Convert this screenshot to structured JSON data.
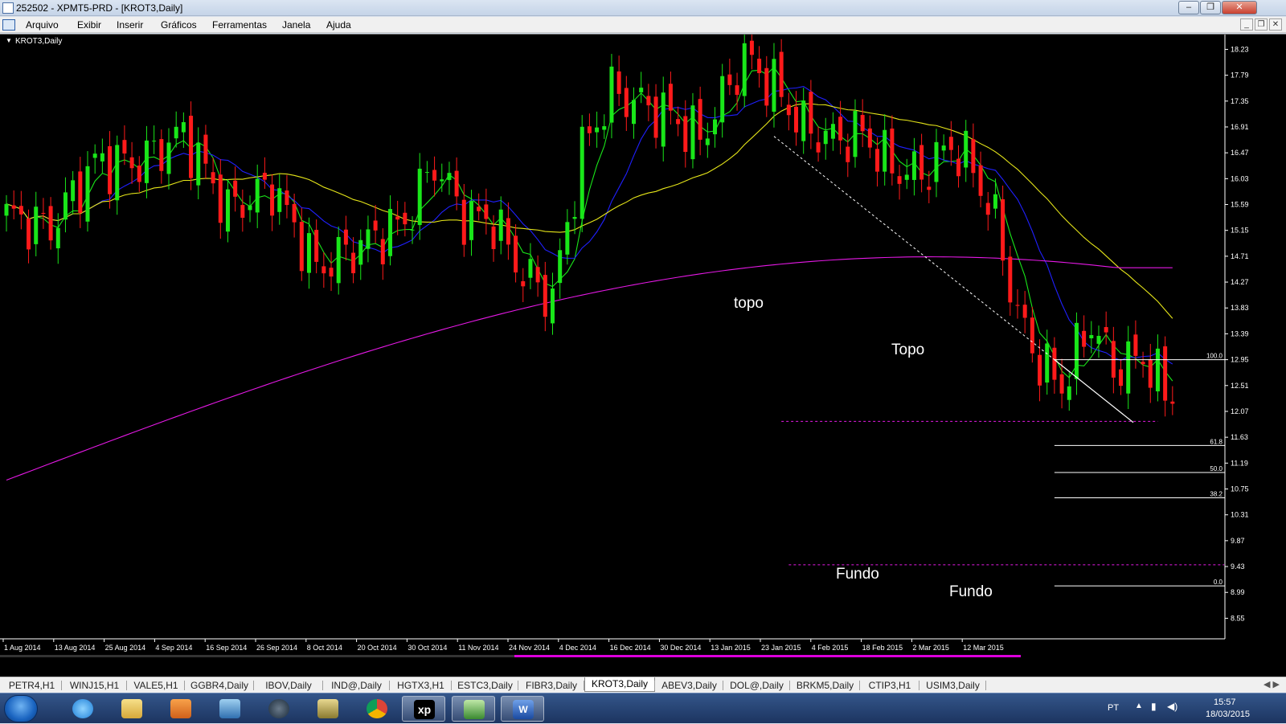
{
  "window": {
    "title": "252502 - XPMT5-PRD - [KROT3,Daily]"
  },
  "menu": [
    "Arquivo",
    "Exibir",
    "Inserir",
    "Gráficos",
    "Ferramentas",
    "Janela",
    "Ajuda"
  ],
  "chart_data": {
    "type": "candlestick",
    "symbol": "KROT3,Daily",
    "ylim": [
      8.2,
      18.4
    ],
    "y_ticks": [
      "18.23",
      "17.79",
      "17.35",
      "16.91",
      "16.47",
      "16.03",
      "15.59",
      "15.15",
      "14.71",
      "14.27",
      "13.83",
      "13.39",
      "12.95",
      "12.51",
      "12.07",
      "11.63",
      "11.19",
      "10.75",
      "10.31",
      "9.87",
      "9.43",
      "8.99",
      "8.55"
    ],
    "x_ticks": [
      "1 Aug 2014",
      "13 Aug 2014",
      "25 Aug 2014",
      "4 Sep 2014",
      "16 Sep 2014",
      "26 Sep 2014",
      "8 Oct 2014",
      "20 Oct 2014",
      "30 Oct 2014",
      "11 Nov 2014",
      "24 Nov 2014",
      "4 Dec 2014",
      "16 Dec 2014",
      "30 Dec 2014",
      "13 Jan 2015",
      "23 Jan 2015",
      "4 Feb 2015",
      "18 Feb 2015",
      "2 Mar 2015",
      "12 Mar 2015"
    ],
    "candle_count": 159,
    "anchors": [
      {
        "bar": 0,
        "close": 15.4
      },
      {
        "bar": 6,
        "close": 15.2
      },
      {
        "bar": 12,
        "close": 16.3
      },
      {
        "bar": 18,
        "close": 16.3
      },
      {
        "bar": 24,
        "close": 16.8
      },
      {
        "bar": 30,
        "close": 15.5
      },
      {
        "bar": 36,
        "close": 15.9
      },
      {
        "bar": 42,
        "close": 14.5
      },
      {
        "bar": 48,
        "close": 14.9
      },
      {
        "bar": 54,
        "close": 15.3
      },
      {
        "bar": 58,
        "close": 16.3
      },
      {
        "bar": 62,
        "close": 15.4
      },
      {
        "bar": 66,
        "close": 15.3
      },
      {
        "bar": 70,
        "close": 14.4
      },
      {
        "bar": 74,
        "close": 14.0
      },
      {
        "bar": 78,
        "close": 16.5
      },
      {
        "bar": 82,
        "close": 17.5
      },
      {
        "bar": 86,
        "close": 17.3
      },
      {
        "bar": 90,
        "close": 17.1
      },
      {
        "bar": 94,
        "close": 16.7
      },
      {
        "bar": 100,
        "close": 18.1
      },
      {
        "bar": 104,
        "close": 17.6
      },
      {
        "bar": 108,
        "close": 16.9
      },
      {
        "bar": 112,
        "close": 16.7
      },
      {
        "bar": 116,
        "close": 16.8
      },
      {
        "bar": 120,
        "close": 16.2
      },
      {
        "bar": 124,
        "close": 16.1
      },
      {
        "bar": 128,
        "close": 16.6
      },
      {
        "bar": 131,
        "close": 16.2
      },
      {
        "bar": 134,
        "close": 15.3
      },
      {
        "bar": 137,
        "close": 13.7
      },
      {
        "bar": 140,
        "close": 12.9
      },
      {
        "bar": 143,
        "close": 12.5
      },
      {
        "bar": 147,
        "close": 13.6
      },
      {
        "bar": 150,
        "close": 12.8
      },
      {
        "bar": 154,
        "close": 13.0
      },
      {
        "bar": 158,
        "close": 12.2
      }
    ],
    "indicators": [
      {
        "name": "MA green",
        "color": "#19e619"
      },
      {
        "name": "MA blue",
        "color": "#2020ff"
      },
      {
        "name": "MA yellow",
        "color": "#e6e619"
      },
      {
        "name": "MA magenta",
        "color": "#e619e6"
      }
    ],
    "trendline_color": "#ffffff",
    "fibonacci": {
      "high": 12.95,
      "low": 9.1,
      "levels": [
        {
          "label": "100.0",
          "price": 12.95
        },
        {
          "label": "61.8",
          "price": 11.49
        },
        {
          "label": "50.0",
          "price": 11.03
        },
        {
          "label": "38.2",
          "price": 10.6
        },
        {
          "label": "0.0",
          "price": 9.1
        }
      ]
    },
    "support_lines": [
      {
        "price": 11.9,
        "color": "#e619e6"
      },
      {
        "price": 9.46,
        "color": "#e619e6"
      }
    ],
    "annotations": [
      "topo",
      "Topo",
      "Fundo",
      "Fundo"
    ]
  },
  "tabs": [
    "PETR4,H1",
    "WINJ15,H1",
    "VALE5,H1",
    "GGBR4,Daily",
    "IBOV,Daily",
    "IND@,Daily",
    "HGTX3,H1",
    "ESTC3,Daily",
    "FIBR3,Daily",
    "KROT3,Daily",
    "ABEV3,Daily",
    "DOL@,Daily",
    "BRKM5,Daily",
    "CTIP3,H1",
    "USIM3,Daily"
  ],
  "active_tab": "KROT3,Daily",
  "taskbar": {
    "apps": [
      "internet-explorer",
      "file-explorer",
      "media-player",
      "network-app",
      "hp-app",
      "archive-app",
      "chrome",
      "xp-app",
      "metatrader",
      "word"
    ],
    "lang": "PT",
    "time": "15:57",
    "date": "18/03/2015"
  }
}
